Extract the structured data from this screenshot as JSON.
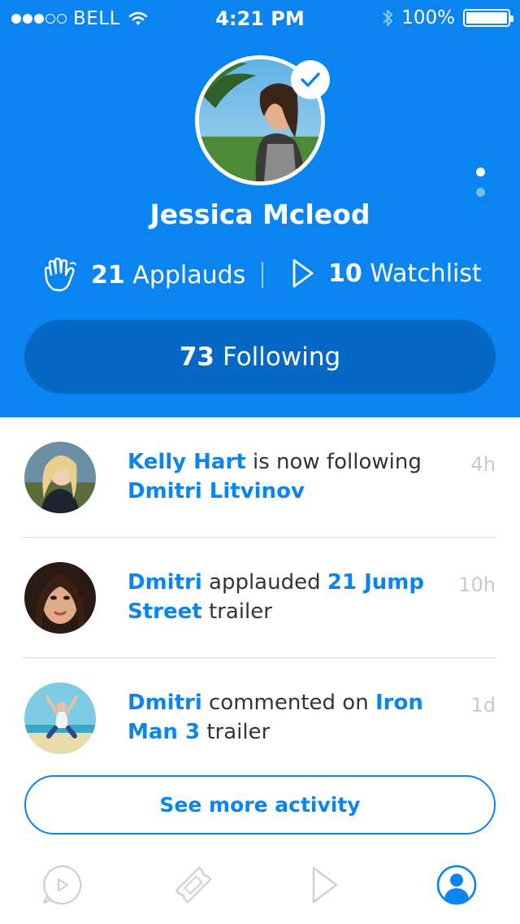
{
  "status_bar": {
    "carrier": "BELL",
    "time": "4:21 PM",
    "battery": "100%",
    "signal_bars_filled": 3,
    "signal_bars_total": 5
  },
  "profile": {
    "name": "Jessica Mcleod",
    "verified": true,
    "applauds_count": "21",
    "applauds_label": "Applauds",
    "watchlist_count": "10",
    "watchlist_label": "Watchlist",
    "following_count": "73",
    "following_label": "Following",
    "pager_total": 2,
    "pager_active": 1
  },
  "activity": [
    {
      "actor": "Kelly Hart",
      "action": " is now following ",
      "target": "Dmitri Litvinov",
      "suffix": "",
      "time": "4h"
    },
    {
      "actor": "Dmitri",
      "action": " applauded ",
      "target": "21 Jump Street",
      "suffix": " trailer",
      "time": "10h"
    },
    {
      "actor": "Dmitri",
      "action": " commented on ",
      "target": "Iron Man 3",
      "suffix": " trailer",
      "time": "1d"
    }
  ],
  "see_more_label": "See more activity",
  "tab_bar": {
    "tabs": [
      {
        "icon": "play-bubble-icon",
        "active": false
      },
      {
        "icon": "ticket-icon",
        "active": false
      },
      {
        "icon": "play-icon",
        "active": false
      },
      {
        "icon": "profile-icon",
        "active": true
      }
    ]
  },
  "colors": {
    "brand_blue": "#0a84f0",
    "button_dark_blue": "#0568c4",
    "timestamp_grey": "#c9c9c9",
    "inactive_icon_grey": "#cfcfcf"
  }
}
